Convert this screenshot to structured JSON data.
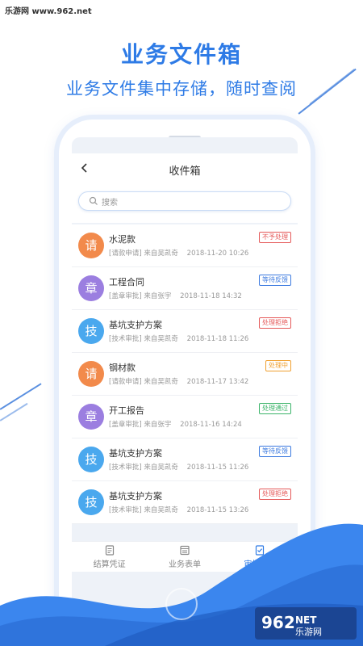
{
  "watermark": "乐游网 www.962.net",
  "hero": {
    "title": "业务文件箱",
    "subtitle": "业务文件集中存储，随时查阅"
  },
  "nav": {
    "back_icon": "chevron-left-icon",
    "title": "收件箱"
  },
  "search": {
    "placeholder": "搜索"
  },
  "items": [
    {
      "avatar": "请",
      "avatar_color": "#f28a4b",
      "title": "水泥款",
      "type": "[请款申请]",
      "from": "来自吴凯奇",
      "time": "2018-11-20 10:26",
      "status": "不予处理",
      "status_color": "#e55a5a"
    },
    {
      "avatar": "章",
      "avatar_color": "#9b7ee0",
      "title": "工程合同",
      "type": "[盖章审批]",
      "from": "来自张宇",
      "time": "2018-11-18 14:32",
      "status": "等待反馈",
      "status_color": "#3d7be0"
    },
    {
      "avatar": "技",
      "avatar_color": "#4aa8ee",
      "title": "基坑支护方案",
      "type": "[技术审批]",
      "from": "来自吴凯奇",
      "time": "2018-11-18 11:26",
      "status": "处理拒绝",
      "status_color": "#e55a5a"
    },
    {
      "avatar": "请",
      "avatar_color": "#f28a4b",
      "title": "钢材款",
      "type": "[请款申请]",
      "from": "来自吴凯奇",
      "time": "2018-11-17 13:42",
      "status": "处理中",
      "status_color": "#f0a030"
    },
    {
      "avatar": "章",
      "avatar_color": "#9b7ee0",
      "title": "开工报告",
      "type": "[盖章审批]",
      "from": "来自张宇",
      "time": "2018-11-16 14:24",
      "status": "处理通过",
      "status_color": "#3cb46a"
    },
    {
      "avatar": "技",
      "avatar_color": "#4aa8ee",
      "title": "基坑支护方案",
      "type": "[技术审批]",
      "from": "来自吴凯奇",
      "time": "2018-11-15 11:26",
      "status": "等待反馈",
      "status_color": "#3d7be0"
    },
    {
      "avatar": "技",
      "avatar_color": "#4aa8ee",
      "title": "基坑支护方案",
      "type": "[技术审批]",
      "from": "来自吴凯奇",
      "time": "2018-11-15 13:26",
      "status": "处理拒绝",
      "status_color": "#e55a5a"
    }
  ],
  "tabs": [
    {
      "label": "结算凭证",
      "icon": "document-icon"
    },
    {
      "label": "业务表单",
      "icon": "form-icon"
    },
    {
      "label": "审批表单",
      "icon": "approval-icon",
      "active": true
    }
  ],
  "logo": {
    "text": "962NET",
    "sub": "乐游网"
  },
  "colors": {
    "accent": "#2e7be6"
  }
}
